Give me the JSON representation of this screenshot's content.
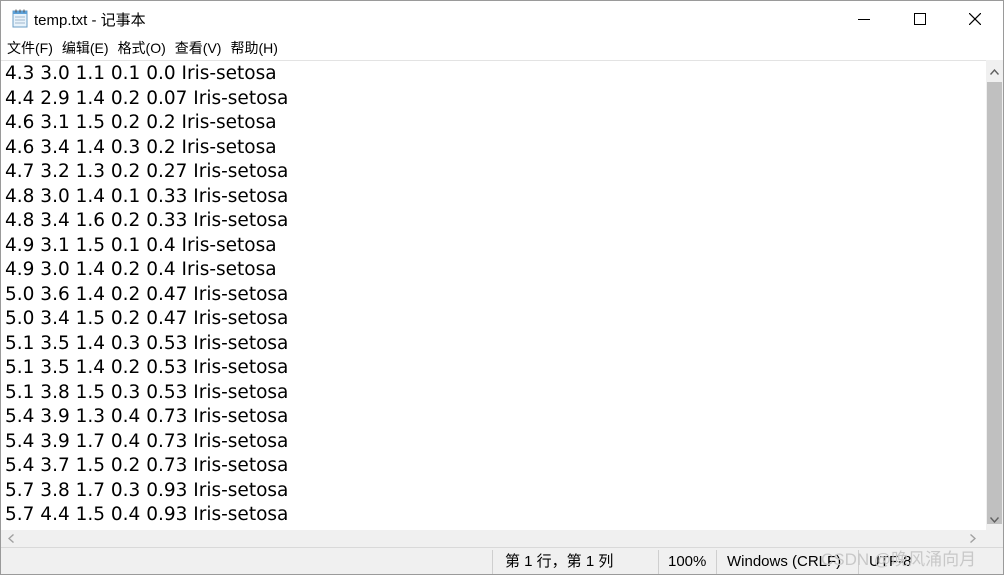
{
  "window": {
    "title": "temp.txt - 记事本"
  },
  "controls": {
    "minimize_icon": "minimize-icon",
    "maximize_icon": "maximize-icon",
    "close_icon": "close-icon"
  },
  "menu": {
    "items": [
      {
        "label": "文件(F)"
      },
      {
        "label": "编辑(E)"
      },
      {
        "label": "格式(O)"
      },
      {
        "label": "查看(V)"
      },
      {
        "label": "帮助(H)"
      }
    ]
  },
  "editor": {
    "lines": [
      "4.3 3.0 1.1 0.1 0.0 Iris-setosa",
      "4.4 2.9 1.4 0.2 0.07 Iris-setosa",
      "4.6 3.1 1.5 0.2 0.2 Iris-setosa",
      "4.6 3.4 1.4 0.3 0.2 Iris-setosa",
      "4.7 3.2 1.3 0.2 0.27 Iris-setosa",
      "4.8 3.0 1.4 0.1 0.33 Iris-setosa",
      "4.8 3.4 1.6 0.2 0.33 Iris-setosa",
      "4.9 3.1 1.5 0.1 0.4 Iris-setosa",
      "4.9 3.0 1.4 0.2 0.4 Iris-setosa",
      "5.0 3.6 1.4 0.2 0.47 Iris-setosa",
      "5.0 3.4 1.5 0.2 0.47 Iris-setosa",
      "5.1 3.5 1.4 0.3 0.53 Iris-setosa",
      "5.1 3.5 1.4 0.2 0.53 Iris-setosa",
      "5.1 3.8 1.5 0.3 0.53 Iris-setosa",
      "5.4 3.9 1.3 0.4 0.73 Iris-setosa",
      "5.4 3.9 1.7 0.4 0.73 Iris-setosa",
      "5.4 3.7 1.5 0.2 0.73 Iris-setosa",
      "5.7 3.8 1.7 0.3 0.93 Iris-setosa",
      "5.7 4.4 1.5 0.4 0.93 Iris-setosa"
    ]
  },
  "status": {
    "position": "第 1 行，第 1 列",
    "zoom": "100%",
    "line_ending": "Windows (CRLF)",
    "encoding": "UTF-8"
  },
  "watermark": "CSDN @晚风涌向月",
  "colors": {
    "scrollbar_track": "#f0f0f0",
    "scrollbar_thumb": "#c0c0c0",
    "status_bg": "#f0f0f0"
  }
}
